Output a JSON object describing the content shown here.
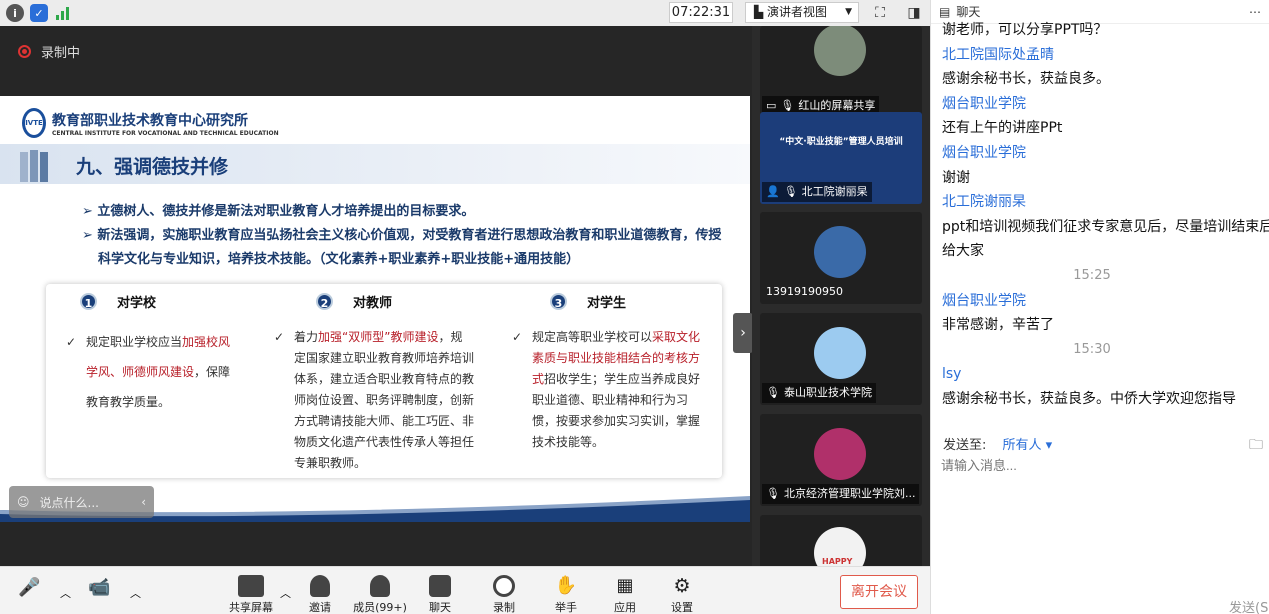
{
  "topbar": {
    "clock": "07:22:31",
    "view_mode": "演讲者视图"
  },
  "stage": {
    "recording_label": "录制中",
    "say_placeholder": "说点什么..."
  },
  "slide": {
    "org_cn": "教育部职业技术教育中心研究所",
    "org_en": "CENTRAL INSTITUTE FOR VOCATIONAL AND TECHNICAL EDUCATION",
    "logo_text": "IVTE",
    "title": "九、强调德技并修",
    "bullets": [
      "➢ 立德树人、德技并修是新法对职业教育人才培养提出的目标要求。",
      "➢ 新法强调，实施职业教育应当弘扬社会主义核心价值观，对受教育者进行思想政治教育和职业道德教育，传授科学文化与专业知识，培养技术技能。（文化素养+职业素养+职业技能+通用技能）"
    ],
    "columns": [
      {
        "num": "1",
        "head": "对学校",
        "pre": "规定职业学校应当",
        "red": "加强校风学风、师德师风建设",
        "post": "，保障教育教学质量。"
      },
      {
        "num": "2",
        "head": "对教师",
        "pre": "着力",
        "red": "加强“双师型”教师建设",
        "post": "，规定国家建立职业教育教师培养培训体系，建立适合职业教育特点的教师岗位设置、职务评聘制度，创新方式聘请技能大师、能工巧匠、非物质文化遗产代表性传承人等担任专兼职教师。"
      },
      {
        "num": "3",
        "head": "对学生",
        "pre": "规定高等职业学校可以",
        "red": "采取文化素质与职业技能相结合的考核方式",
        "post": "招收学生；学生应当养成良好职业道德、职业精神和行为习惯，按要求参加实习实训，掌握技术技能等。"
      }
    ]
  },
  "video": {
    "tiles": [
      {
        "label": "红山的屏幕共享",
        "color": "#7d8c7a"
      },
      {
        "label": "北工院谢丽杲",
        "color": "#1c3d7a",
        "banner": "“中文·职业技能”管理人员培训"
      },
      {
        "label": "13919190950",
        "color": "#3a6aa8"
      },
      {
        "label": "泰山职业技术学院",
        "color": "#9ccbf0"
      },
      {
        "label": "北京经济管理职业学院刘...",
        "color": "#b0306a"
      },
      {
        "label": "",
        "color": "#f2f2f2",
        "badge": "HAPPY"
      }
    ]
  },
  "chat": {
    "title": "聊天",
    "messages": [
      {
        "type": "text",
        "text": "谢老师，可以分享PPT吗？"
      },
      {
        "type": "sender",
        "text": "北工院国际处孟晴"
      },
      {
        "type": "text",
        "text": "感谢余秘书长，获益良多。"
      },
      {
        "type": "sender",
        "text": "烟台职业学院"
      },
      {
        "type": "text",
        "text": "还有上午的讲座PPt"
      },
      {
        "type": "sender",
        "text": "烟台职业学院"
      },
      {
        "type": "text",
        "text": "谢谢"
      },
      {
        "type": "sender",
        "text": "北工院谢丽杲"
      },
      {
        "type": "text",
        "text": "ppt和培训视频我们征求专家意见后，尽量培训结束后"
      },
      {
        "type": "text",
        "text": "给大家"
      },
      {
        "type": "time",
        "text": "15:25"
      },
      {
        "type": "sender",
        "text": "烟台职业学院"
      },
      {
        "type": "text",
        "text": "非常感谢，辛苦了"
      },
      {
        "type": "time",
        "text": "15:30"
      },
      {
        "type": "sender",
        "text": "lsy"
      },
      {
        "type": "text",
        "text": "感谢余秘书长，获益良多。中侨大学欢迎您指导"
      }
    ],
    "send_to_label": "发送至:",
    "send_to_value": "所有人",
    "input_placeholder": "请输入消息...",
    "send_label": "发送(S"
  },
  "toolbar": {
    "items": [
      "共享屏幕",
      "邀请",
      "成员(99+)",
      "聊天",
      "录制",
      "举手",
      "应用",
      "设置"
    ],
    "leave": "离开会议"
  }
}
